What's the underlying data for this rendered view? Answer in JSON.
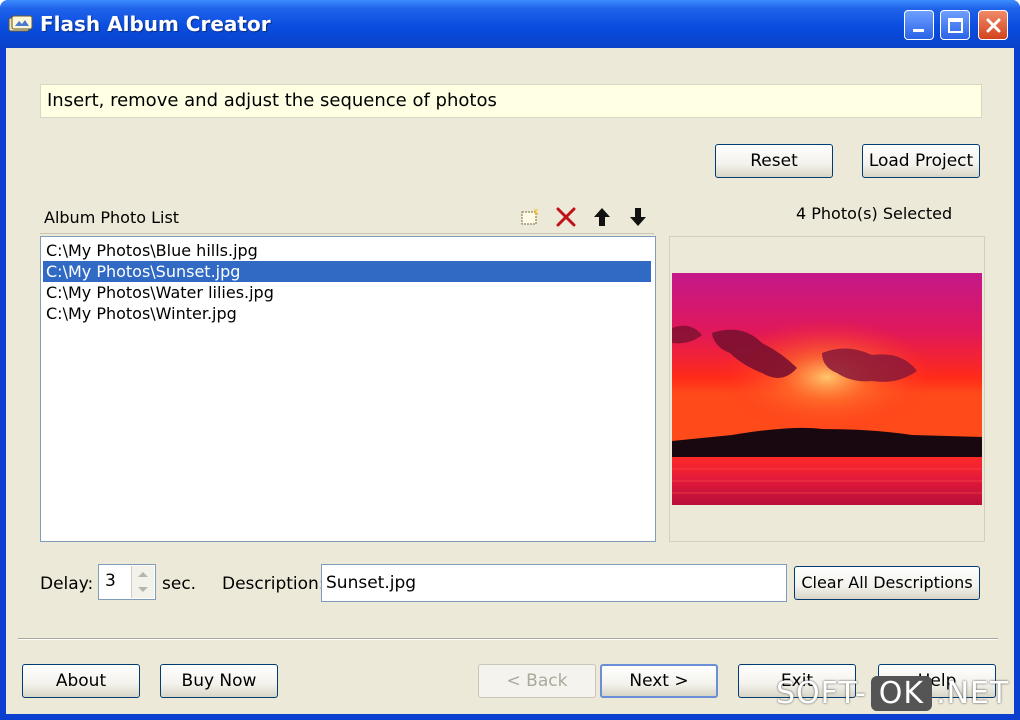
{
  "window": {
    "title": "Flash Album Creator"
  },
  "instruction": "Insert, remove and adjust the sequence of photos",
  "top_buttons": {
    "reset": "Reset",
    "load_project": "Load Project"
  },
  "photo_list": {
    "title": "Album Photo List",
    "items": [
      "C:\\My Photos\\Blue hills.jpg",
      "C:\\My Photos\\Sunset.jpg",
      "C:\\My Photos\\Water lilies.jpg",
      "C:\\My Photos\\Winter.jpg"
    ],
    "selected_index": 1,
    "toolbar_icons": [
      "add-icon",
      "remove-icon",
      "move-up-icon",
      "move-down-icon"
    ]
  },
  "selection_count": "4 Photo(s) Selected",
  "delay": {
    "label": "Delay:",
    "value": "3",
    "unit": "sec."
  },
  "description": {
    "label": "Description:",
    "value": "Sunset.jpg"
  },
  "clear_button": "Clear All Descriptions",
  "bottom_buttons": {
    "about": "About",
    "buy_now": "Buy Now",
    "back": "< Back",
    "next": "Next >",
    "exit": "Exit",
    "help": "Help"
  },
  "watermark": {
    "left": "SOFT-",
    "middle": "OK",
    "right": ".NET"
  },
  "colors": {
    "titlebar": "#0a4de0",
    "selection": "#316ac5",
    "face": "#ece9d8",
    "instruction_bg": "#ffffe4"
  }
}
